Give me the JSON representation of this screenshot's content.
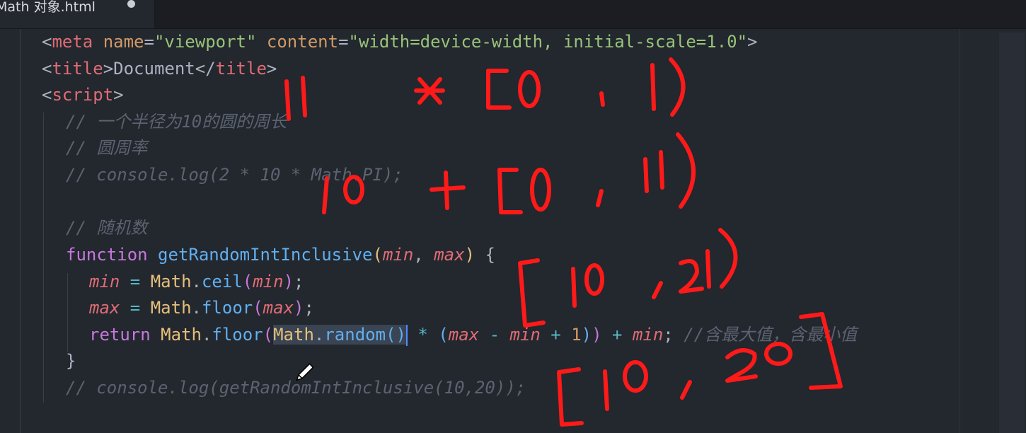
{
  "tab": {
    "title": "Math 对象.html",
    "modified": true
  },
  "code": {
    "meta_open": "<",
    "meta_tag": "meta",
    "meta_attr1": "name",
    "meta_eq1": "=",
    "meta_val1": "\"viewport\"",
    "meta_attr2": "content",
    "meta_eq2": "=",
    "meta_val2": "\"width=device-width, initial-scale=1.0\"",
    "meta_close": ">",
    "title_open": "<",
    "title_tag": "title",
    "title_gt": ">",
    "title_text": "Document",
    "title_end_open": "</",
    "title_end_tag": "title",
    "title_end_gt": ">",
    "script_open": "<",
    "script_tag": "script",
    "script_gt": ">",
    "comment1": "// 一个半径为10的圆的周长",
    "comment2": "// 圆周率",
    "comment3": "// console.log(2 * 10 * Math.PI);",
    "comment4": "// 随机数",
    "fn_keyword": "function",
    "fn_name": "getRandomIntInclusive",
    "fn_paren_open": "(",
    "fn_param1": "min",
    "fn_comma": ", ",
    "fn_param2": "max",
    "fn_paren_close": ")",
    "fn_brace": " {",
    "l1_var": "min",
    "l1_eq": " = ",
    "l1_obj": "Math",
    "l1_dot": ".",
    "l1_method": "ceil",
    "l1_po": "(",
    "l1_arg": "min",
    "l1_pc": ")",
    "l1_semi": ";",
    "l2_var": "max",
    "l2_eq": " = ",
    "l2_obj": "Math",
    "l2_dot": ".",
    "l2_method": "floor",
    "l2_po": "(",
    "l2_arg": "max",
    "l2_pc": ")",
    "l2_semi": ";",
    "l3_return": "return",
    "l3_obj": "Math",
    "l3_dot": ".",
    "l3_method": "floor",
    "l3_po": "(",
    "l3_sel_obj": "Math",
    "l3_sel_dot": ".",
    "l3_sel_method": "random",
    "l3_sel_parens": "()",
    "l3_mul": " * ",
    "l3_po2": "(",
    "l3_max": "max",
    "l3_minus": " - ",
    "l3_min": "min",
    "l3_plus": " + ",
    "l3_one": "1",
    "l3_pc2": ")",
    "l3_pc1": ")",
    "l3_plus2": " + ",
    "l3_min2": "min",
    "l3_semi": ";",
    "l3_comment": " //含最大值，含最小值",
    "close_brace": "}",
    "comment5": "// console.log(getRandomIntInclusive(10,20));"
  },
  "colors": {
    "background": "#23272e",
    "annotation_ink": "#ff1a1a"
  },
  "annotations": {
    "row1": [
      "11",
      "*",
      "[0",
      ",",
      "1)"
    ],
    "row2": [
      "10",
      "+",
      "[0",
      ",",
      "11)"
    ],
    "row3": [
      "[10",
      ",",
      "21)"
    ],
    "row4": [
      "[10",
      ",",
      "20]"
    ]
  }
}
